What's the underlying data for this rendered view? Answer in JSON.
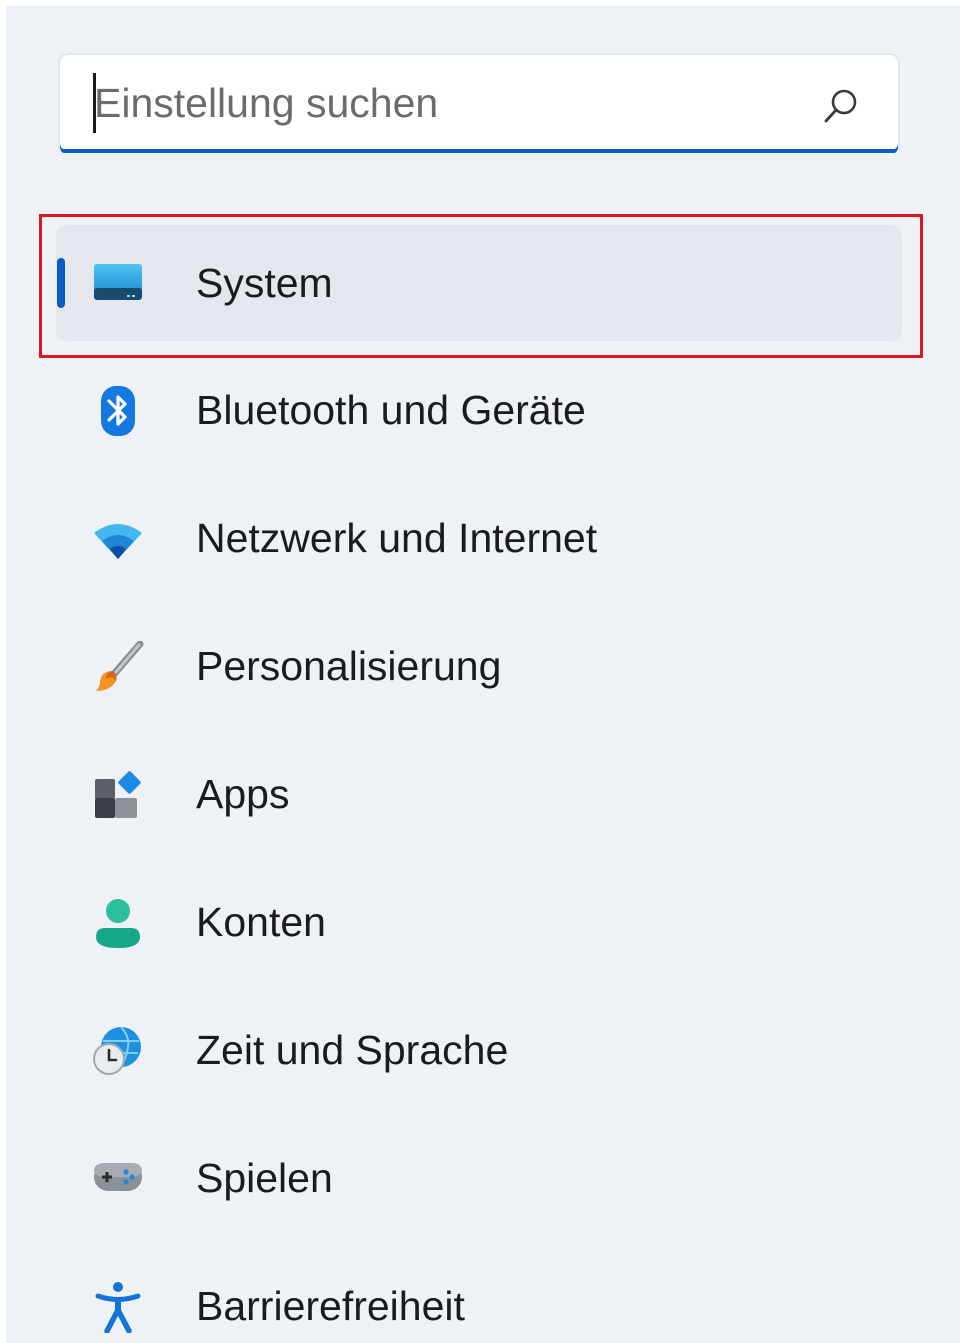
{
  "search": {
    "placeholder": "Einstellung suchen",
    "value": "",
    "underline_color": "#0b5cc0"
  },
  "nav": {
    "items": [
      {
        "label": "System",
        "icon": "system-monitor-icon",
        "selected": true
      },
      {
        "label": "Bluetooth und Geräte",
        "icon": "bluetooth-icon",
        "selected": false
      },
      {
        "label": "Netzwerk und Internet",
        "icon": "wifi-icon",
        "selected": false
      },
      {
        "label": "Personalisierung",
        "icon": "paintbrush-icon",
        "selected": false
      },
      {
        "label": "Apps",
        "icon": "apps-icon",
        "selected": false
      },
      {
        "label": "Konten",
        "icon": "account-icon",
        "selected": false
      },
      {
        "label": "Zeit und Sprache",
        "icon": "globe-clock-icon",
        "selected": false
      },
      {
        "label": "Spielen",
        "icon": "gamepad-icon",
        "selected": false
      },
      {
        "label": "Barrierefreiheit",
        "icon": "accessibility-icon",
        "selected": false
      }
    ]
  },
  "colors": {
    "accent": "#0b5cc0",
    "sidebar_bg": "#eef2f7",
    "selected_bg": "#e4e8ee",
    "highlight_border": "#e0161e"
  }
}
